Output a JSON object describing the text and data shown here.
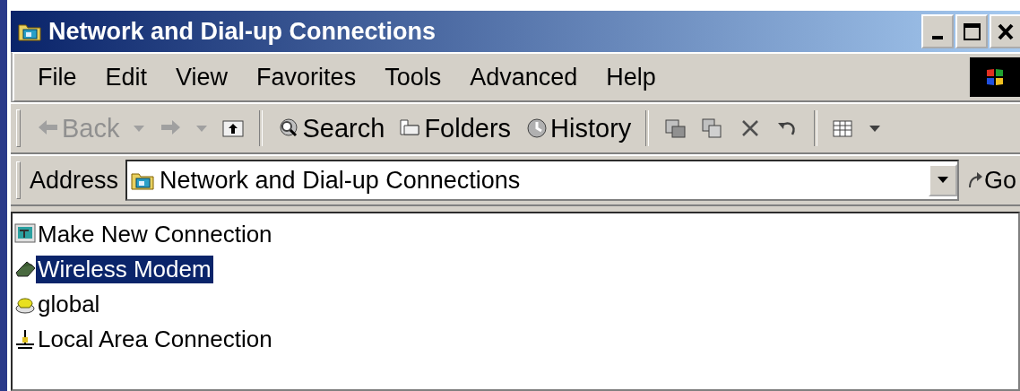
{
  "window": {
    "title": "Network and Dial-up Connections"
  },
  "menu": [
    {
      "label": "File"
    },
    {
      "label": "Edit"
    },
    {
      "label": "View"
    },
    {
      "label": "Favorites"
    },
    {
      "label": "Tools"
    },
    {
      "label": "Advanced"
    },
    {
      "label": "Help"
    }
  ],
  "toolbar": [
    {
      "kind": "back",
      "label": "Back",
      "disabled": true
    },
    {
      "kind": "forward",
      "disabled": true
    },
    {
      "kind": "up"
    },
    {
      "kind": "separator"
    },
    {
      "kind": "search",
      "label": "Search"
    },
    {
      "kind": "folders",
      "label": "Folders"
    },
    {
      "kind": "history",
      "label": "History"
    },
    {
      "kind": "separator"
    },
    {
      "kind": "move"
    },
    {
      "kind": "copy"
    },
    {
      "kind": "delete"
    },
    {
      "kind": "undo"
    },
    {
      "kind": "separator"
    },
    {
      "kind": "views"
    }
  ],
  "address_bar": {
    "label": "Address",
    "value": "Network and Dial-up Connections",
    "go": "Go"
  },
  "items": [
    {
      "kind": "wizard",
      "name": "Make New Connection",
      "selected": false
    },
    {
      "kind": "modem",
      "name": "Wireless Modem",
      "selected": true
    },
    {
      "kind": "dialup",
      "name": "global",
      "selected": false
    },
    {
      "kind": "lan",
      "name": "Local Area Connection",
      "selected": false
    }
  ]
}
